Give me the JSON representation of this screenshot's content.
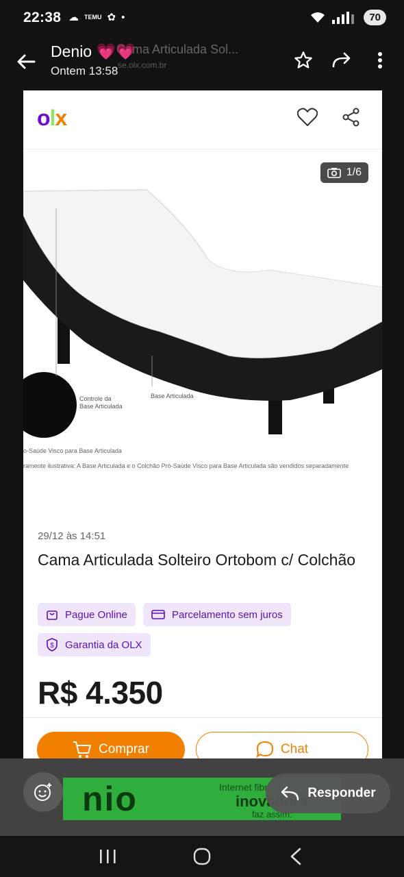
{
  "status_bar": {
    "time": "22:38",
    "notification_temu": "TEMU",
    "battery": "70"
  },
  "viewer": {
    "sender": "Denio 💗💗",
    "timestamp": "Ontem 13:58",
    "ghost_title": "Cama Articulada Sol...",
    "ghost_url": "se.olx.com.br",
    "reply_label": "Responder"
  },
  "olx": {
    "logo_o": "o",
    "logo_l": "l",
    "logo_x": "x",
    "photo_counter": "1/6",
    "photo_caption_control": "Controle da\nBase Articulada",
    "photo_caption_base": "Base Articulada",
    "photo_caption_line1": "o-Saúde Visco para Base Articulada",
    "photo_caption_line2": "ramente ilustrativa: A Base Articulada e o Colchão Pró-Saúde Visco para Base Articulada são vendidos separadamente",
    "ad_date": "29/12 às 14:51",
    "ad_title": "Cama Articulada Solteiro Ortobom c/ Colchão",
    "badges": [
      {
        "label": "Pague Online",
        "icon": "bag-icon"
      },
      {
        "label": "Parcelamento sem juros",
        "icon": "card-icon"
      },
      {
        "label": "Garantia da OLX",
        "icon": "shield-dollar-icon"
      }
    ],
    "price": "R$ 4.350",
    "buy_label": "Comprar",
    "chat_label": "Chat"
  },
  "banner": {
    "brand": "nio",
    "line1": "Internet fibra",
    "line2": "inovadora",
    "line3": "faz assim."
  },
  "colors": {
    "olx_purple": "#6e0ad6",
    "olx_orange": "#f28000",
    "olx_green": "#8ce563",
    "badge_bg": "#f0e6fb"
  }
}
